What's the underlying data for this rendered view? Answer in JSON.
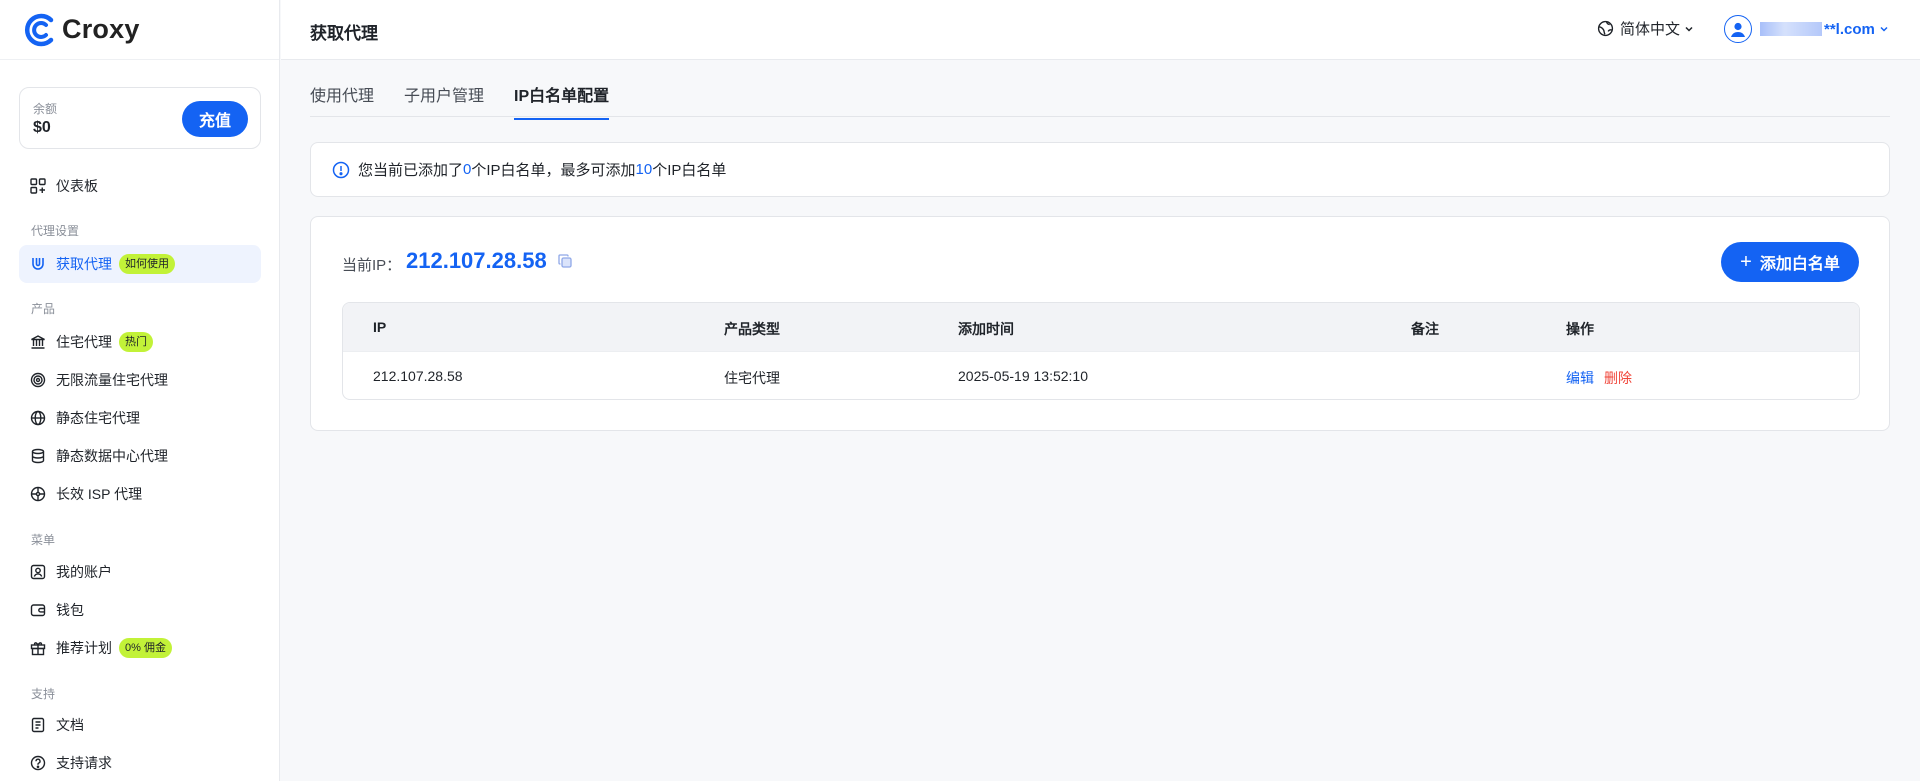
{
  "brand": {
    "name": "Croxy",
    "accent": "#1463f3",
    "badge_color": "#c2f238"
  },
  "sidebar": {
    "balance": {
      "label": "余额",
      "value": "$0",
      "recharge_label": "充值"
    },
    "dashboard_label": "仪表板",
    "sections": {
      "proxy_settings": "代理设置",
      "products": "产品",
      "menu": "菜单",
      "support": "支持"
    },
    "get_proxy": {
      "label": "获取代理",
      "badge": "如何使用"
    },
    "products": [
      {
        "label": "住宅代理",
        "badge": "热门",
        "icon": "bank-icon"
      },
      {
        "label": "无限流量住宅代理",
        "icon": "target-icon"
      },
      {
        "label": "静态住宅代理",
        "icon": "globe-icon"
      },
      {
        "label": "静态数据中心代理",
        "icon": "database-icon"
      },
      {
        "label": "长效 ISP 代理",
        "icon": "network-icon"
      }
    ],
    "menu": [
      {
        "label": "我的账户",
        "icon": "user-card-icon"
      },
      {
        "label": "钱包",
        "icon": "wallet-icon"
      },
      {
        "label": "推荐计划",
        "badge": "0% 佣金",
        "icon": "gift-icon"
      }
    ],
    "support": [
      {
        "label": "文档",
        "icon": "document-icon"
      },
      {
        "label": "支持请求",
        "icon": "support-icon"
      }
    ]
  },
  "header": {
    "title": "获取代理",
    "language": "简体中文",
    "user_email_suffix": "**l.com"
  },
  "tabs": [
    {
      "label": "使用代理",
      "active": false
    },
    {
      "label": "子用户管理",
      "active": false
    },
    {
      "label": "IP白名单配置",
      "active": true
    }
  ],
  "notice": {
    "prefix": "您当前已添加了",
    "count": "0",
    "middle": "个IP白名单，最多可添加",
    "max": "10",
    "suffix": "个IP白名单"
  },
  "whitelist": {
    "current_ip_label": "当前IP：",
    "current_ip": "212.107.28.58",
    "add_button": "添加白名单",
    "columns": [
      "IP",
      "产品类型",
      "添加时间",
      "备注",
      "操作"
    ],
    "rows": [
      {
        "ip": "212.107.28.58",
        "product": "住宅代理",
        "added": "2025-05-19 13:52:10",
        "note": "",
        "edit": "编辑",
        "delete": "删除"
      }
    ]
  }
}
